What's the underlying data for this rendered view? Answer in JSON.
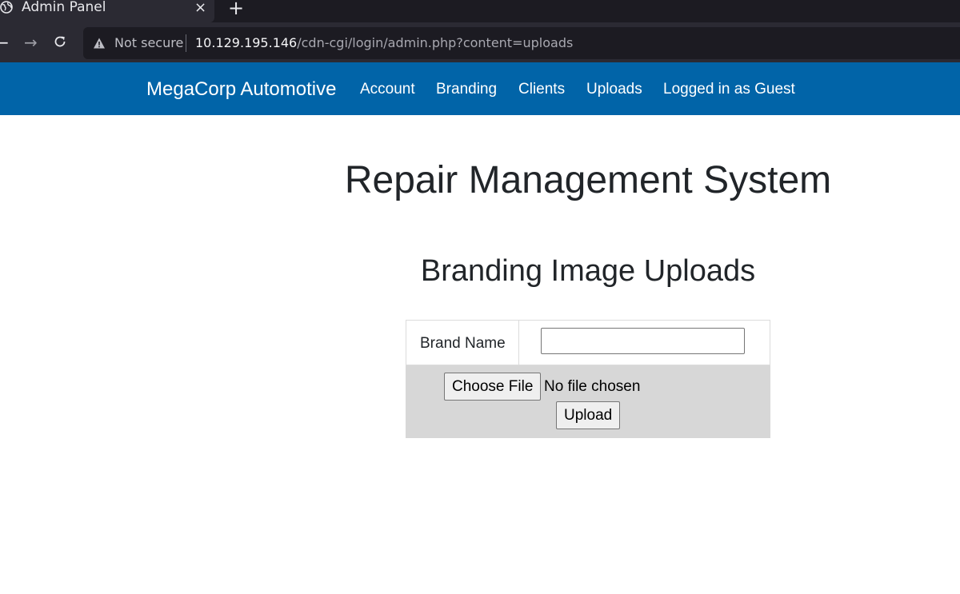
{
  "browser": {
    "tab": {
      "title": "Admin Panel",
      "favicon": "globe-icon",
      "close_glyph": "×"
    },
    "new_tab_glyph": "+",
    "nav_icons": [
      "back-arrow-icon",
      "forward-arrow-icon",
      "reload-icon"
    ],
    "address": {
      "security_label": "Not secure",
      "url_host": "10.129.195.146",
      "url_path": "/cdn-cgi/login/admin.php?content=uploads"
    }
  },
  "navbar": {
    "brand": "MegaCorp Automotive",
    "links": [
      "Account",
      "Branding",
      "Clients",
      "Uploads",
      "Logged in as Guest"
    ],
    "background_color": "#0164a8"
  },
  "main": {
    "title": "Repair Management System",
    "section_title": "Branding Image Uploads",
    "form": {
      "brand_label": "Brand Name",
      "brand_value": "",
      "file_button": "Choose File",
      "file_status": "No file chosen",
      "submit_label": "Upload"
    }
  }
}
